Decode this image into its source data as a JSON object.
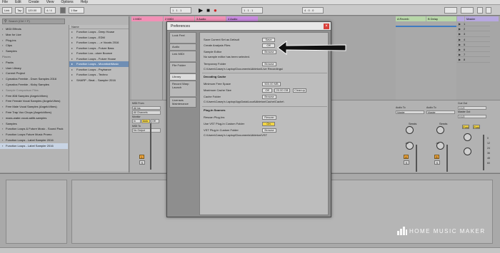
{
  "menu": [
    "File",
    "Edit",
    "Create",
    "View",
    "Options",
    "Help"
  ],
  "control_bar": {
    "link": "Link",
    "tap": "Tap",
    "tempo": "120.00",
    "signature": "4 / 4",
    "quantize": "1 Bar",
    "position": "1 . 1 . 1",
    "loop_length": "4 . 0 . 0"
  },
  "browser": {
    "search_placeholder": "Search (Ctrl + F)",
    "categories": [
      "MIDI Effects",
      "Max for Live",
      "Plug-ins",
      "Clips",
      "Samples"
    ],
    "places_header": "Places",
    "places": [
      "Packs",
      "User Library",
      "Current Project",
      "Cymatics Freebie - Drum Samples 2016",
      "Cymatics Freebie - Kicky Samples",
      "Sample Comparison Files",
      "Free 808 Samples (AngeloVibes)",
      "Free Female Vocal Samples (AngeloVibes)",
      "Free Male Vocal Samples (AngeloVibes)",
      "Free Trap Vox Chops (AngeloVibes)",
      "maxs-water-vocal-adlib-samples",
      "Samples",
      "Function Loops & Future Music - Sound Pack",
      "Function Loops Future Music Promo",
      "Function Loops - Label Sampler 2016",
      "Function Loops - Label Sampler 2016"
    ],
    "file_header": "Name",
    "files": [
      "Function Loops - Deep House",
      "Function Loops - EDM",
      "Function Loops - ...e Vocals 2016",
      "Function Loops - Future Bass",
      "Function Loo...uture Bounce",
      "Function Loops - Future House",
      "Function Loops - MoombahMusic",
      "Function Loops - Psytrance",
      "Function Loops - Techno",
      "SHARP - Beat... Sampler 2016"
    ],
    "selected_file_index": 6
  },
  "session": {
    "tracks": [
      {
        "label": "1 MIDI",
        "color": "#f290b6"
      },
      {
        "label": "2 MIDI",
        "color": "#f290b6"
      },
      {
        "label": "3 Audio",
        "color": "#f290b6"
      },
      {
        "label": "4 Audio",
        "color": "#c98ae0"
      },
      {
        "label": "A Reverb",
        "color": "#b7d7a8"
      },
      {
        "label": "B Delay",
        "color": "#b7d7a8"
      },
      {
        "label": "",
        "color": "#b7a8e0"
      },
      {
        "label": "Master",
        "color": "#b7a8e0"
      }
    ],
    "master_scenes": [
      "1",
      "2",
      "3",
      "4",
      "5",
      "6",
      "7",
      "8"
    ],
    "midi_from_label": "MIDI From",
    "midi_from_value": "All Ins",
    "channel_value": "All Channels",
    "monitor_label": "Monitor",
    "monitor_options": [
      "In",
      "Auto",
      "Off"
    ],
    "midi_to_label": "MIDI To",
    "midi_to_value": "No Output",
    "track_number": "1",
    "audio_to_label": "Audio To",
    "audio_to_value": "Master",
    "sends_label": "Sends",
    "cue_out_label": "Cue Out",
    "cue_out_value": "ii 1/2",
    "master_out_label": "Master Out",
    "master_out_value": "ii 1/2",
    "post_label": "Post",
    "solo_label": "S",
    "fader_scale": [
      "0",
      "12",
      "24",
      "36",
      "48",
      "60"
    ],
    "inf_label": "-inf"
  },
  "preferences": {
    "title": "Preferences",
    "tabs": [
      {
        "label": "Look Feel",
        "active": false
      },
      {
        "label": "Audio",
        "active": false
      },
      {
        "label": "Link MIDI",
        "active": false
      },
      {
        "label": "File Folder",
        "active": false
      },
      {
        "label": "Library",
        "active": true
      },
      {
        "label": "Record Warp Launch",
        "active": false
      },
      {
        "label": "Licenses Maintenance",
        "active": false
      }
    ],
    "save_current_set": "Save Current Set as Default",
    "save_button": "Save",
    "create_analysis": "Create Analysis Files",
    "create_analysis_value": "Off",
    "sample_editor": "Sample Editor",
    "browse": "Browse",
    "no_editor": "No sample editor has been selected.",
    "temporary_folder": "Temporary Folder",
    "temporary_path": "C:\\Users\\Casey's Laptop\\Documents\\Ableton\\Live Recordings\\",
    "decoding_cache": "Decoding Cache",
    "min_free_space": "Minimum Free Space",
    "min_free_space_value": "500.00 MB",
    "max_cache_size": "Maximum Cache Size",
    "max_cache_size_state": "Off",
    "max_cache_size_value": "20.00 GB",
    "cleanup": "Cleanup",
    "cache_folder": "Cache Folder",
    "cache_path": "C:\\Users\\Casey's Laptop\\AppData\\Local\\Ableton\\Cache\\Cache\\",
    "plugin_sources": "Plug-In Sources",
    "rescan_plugins": "Rescan Plug-Ins",
    "rescan_button": "Rescan",
    "use_vst_custom": "Use VST Plug-In Custom Folder",
    "use_vst_custom_value": "On",
    "vst_custom_folder": "VST Plug-In Custom Folder",
    "vst_path": "C:\\Users\\Casey's Laptop\\Documents\\Ableton\\VST"
  },
  "watermark": "HOME MUSIC MAKER",
  "colors": {
    "title_close": "#d9403a",
    "selected_row": "#6f8eb4",
    "toggle_on": "#f2d445",
    "solo": "#f0a43a"
  }
}
